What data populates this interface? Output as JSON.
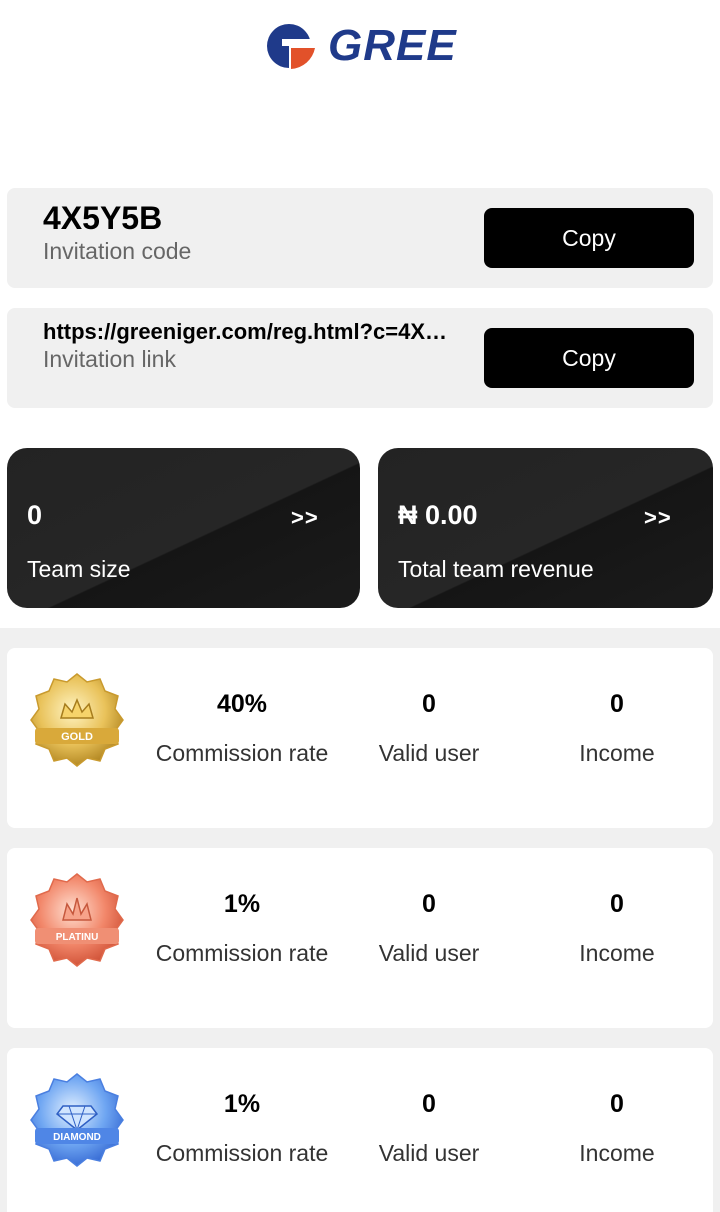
{
  "brand": {
    "name": "GREE",
    "primary_color": "#1f3a8a",
    "accent_color": "#e2512a"
  },
  "invitation": {
    "code": "4X5Y5B",
    "code_label": "Invitation code",
    "link": "https://greeniger.com/reg.html?c=4X…",
    "link_label": "Invitation link",
    "copy_label": "Copy"
  },
  "team": {
    "size_value": "0",
    "size_label": "Team size",
    "revenue_value": "₦ 0.00",
    "revenue_label": "Total team revenue",
    "arrow": ">>"
  },
  "levels": [
    {
      "badge": "gold-badge-icon",
      "badge_text": "GOLD",
      "commission": "40%",
      "commission_label": "Commission rate",
      "valid_users": "0",
      "valid_users_label": "Valid user",
      "income": "0",
      "income_label": "Income"
    },
    {
      "badge": "platinum-badge-icon",
      "badge_text": "PLATINU",
      "commission": "1%",
      "commission_label": "Commission rate",
      "valid_users": "0",
      "valid_users_label": "Valid user",
      "income": "0",
      "income_label": "Income"
    },
    {
      "badge": "diamond-badge-icon",
      "badge_text": "DIAMOND",
      "commission": "1%",
      "commission_label": "Commission rate",
      "valid_users": "0",
      "valid_users_label": "Valid user",
      "income": "0",
      "income_label": "Income"
    }
  ]
}
